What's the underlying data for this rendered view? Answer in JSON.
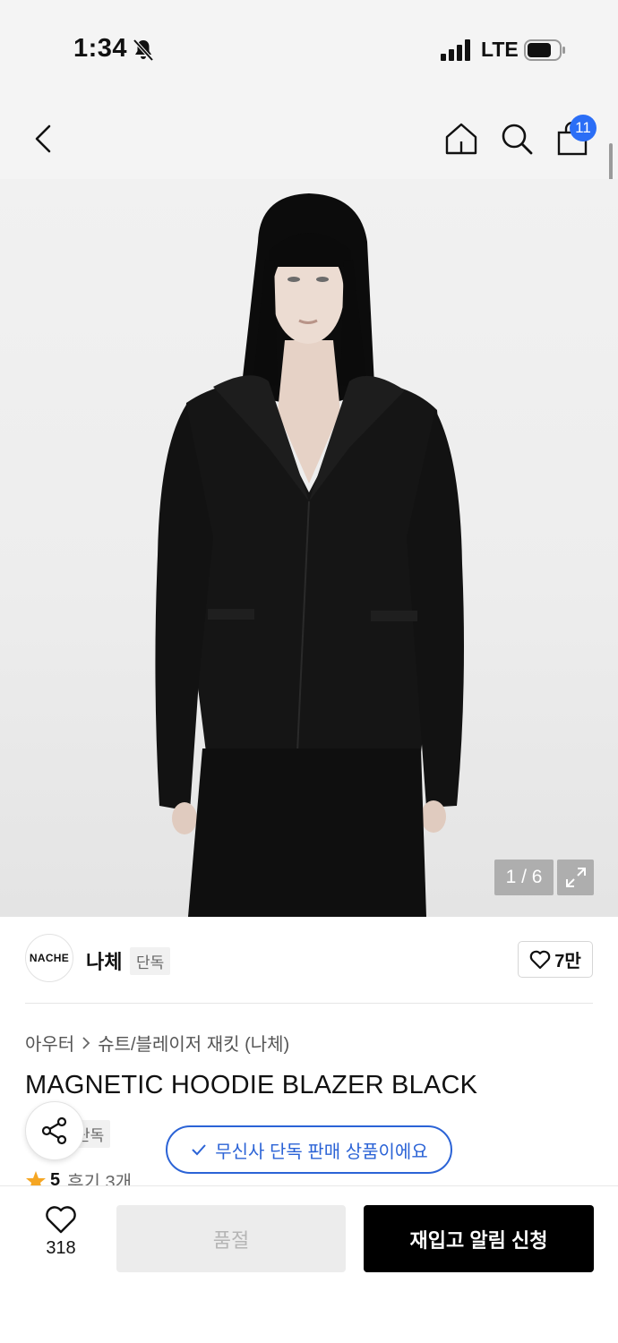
{
  "status_bar": {
    "time": "1:34",
    "network": "LTE"
  },
  "header": {
    "cart_count": "11"
  },
  "gallery": {
    "counter": "1 / 6"
  },
  "brand": {
    "logo_text": "NACHE",
    "name": "나체",
    "tag": "단독",
    "like_count": "7만"
  },
  "breadcrumb": {
    "category": "아우터",
    "subcategory": "슈트/블레이저 재킷 (나체)"
  },
  "product": {
    "title": "MAGNETIC HOODIE BLAZER BLACK",
    "tag_partial": "단독",
    "exclusive_notice": "무신사 단독 판매 상품이에요",
    "rating": "5",
    "reviews": "후기 3개"
  },
  "bottom_bar": {
    "like_count": "318",
    "soldout_label": "품절",
    "restock_label": "재입고 알림 신청"
  },
  "colors": {
    "accent_blue": "#2b63d6",
    "badge_blue": "#2b6ef6",
    "star": "#f5a623"
  }
}
